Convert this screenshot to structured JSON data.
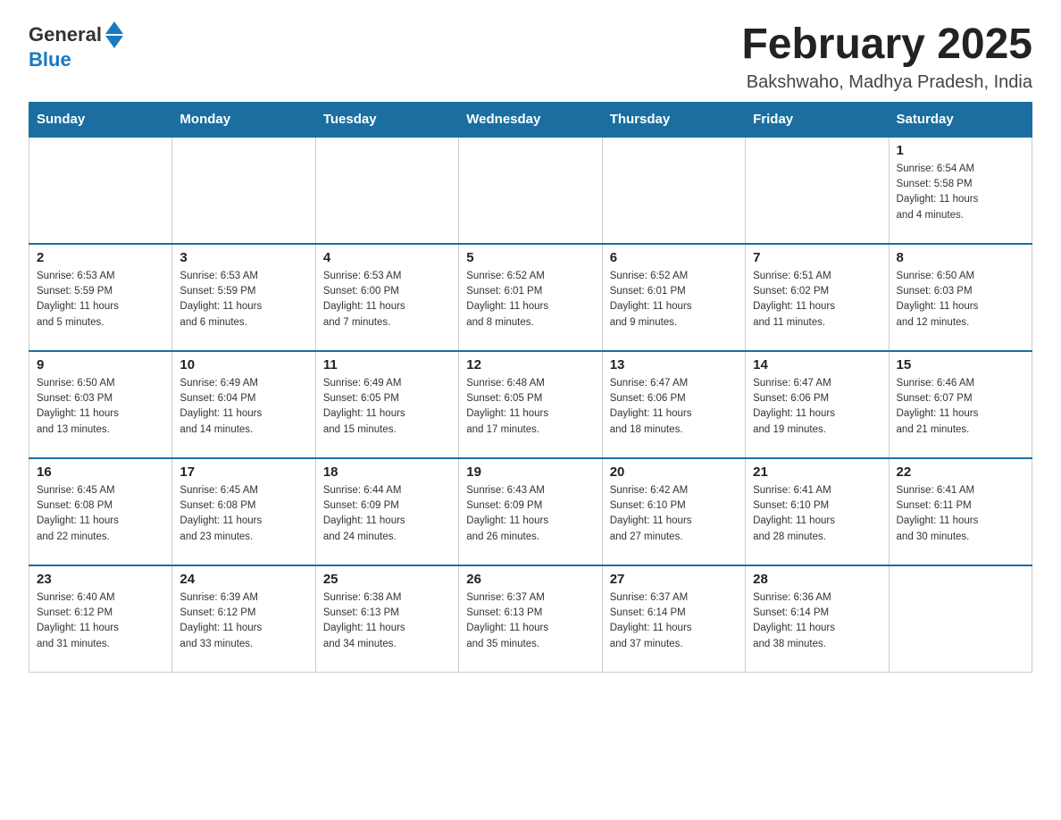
{
  "header": {
    "logo_general": "General",
    "logo_blue": "Blue",
    "title": "February 2025",
    "subtitle": "Bakshwaho, Madhya Pradesh, India"
  },
  "weekdays": [
    "Sunday",
    "Monday",
    "Tuesday",
    "Wednesday",
    "Thursday",
    "Friday",
    "Saturday"
  ],
  "weeks": [
    [
      {
        "day": "",
        "info": ""
      },
      {
        "day": "",
        "info": ""
      },
      {
        "day": "",
        "info": ""
      },
      {
        "day": "",
        "info": ""
      },
      {
        "day": "",
        "info": ""
      },
      {
        "day": "",
        "info": ""
      },
      {
        "day": "1",
        "info": "Sunrise: 6:54 AM\nSunset: 5:58 PM\nDaylight: 11 hours\nand 4 minutes."
      }
    ],
    [
      {
        "day": "2",
        "info": "Sunrise: 6:53 AM\nSunset: 5:59 PM\nDaylight: 11 hours\nand 5 minutes."
      },
      {
        "day": "3",
        "info": "Sunrise: 6:53 AM\nSunset: 5:59 PM\nDaylight: 11 hours\nand 6 minutes."
      },
      {
        "day": "4",
        "info": "Sunrise: 6:53 AM\nSunset: 6:00 PM\nDaylight: 11 hours\nand 7 minutes."
      },
      {
        "day": "5",
        "info": "Sunrise: 6:52 AM\nSunset: 6:01 PM\nDaylight: 11 hours\nand 8 minutes."
      },
      {
        "day": "6",
        "info": "Sunrise: 6:52 AM\nSunset: 6:01 PM\nDaylight: 11 hours\nand 9 minutes."
      },
      {
        "day": "7",
        "info": "Sunrise: 6:51 AM\nSunset: 6:02 PM\nDaylight: 11 hours\nand 11 minutes."
      },
      {
        "day": "8",
        "info": "Sunrise: 6:50 AM\nSunset: 6:03 PM\nDaylight: 11 hours\nand 12 minutes."
      }
    ],
    [
      {
        "day": "9",
        "info": "Sunrise: 6:50 AM\nSunset: 6:03 PM\nDaylight: 11 hours\nand 13 minutes."
      },
      {
        "day": "10",
        "info": "Sunrise: 6:49 AM\nSunset: 6:04 PM\nDaylight: 11 hours\nand 14 minutes."
      },
      {
        "day": "11",
        "info": "Sunrise: 6:49 AM\nSunset: 6:05 PM\nDaylight: 11 hours\nand 15 minutes."
      },
      {
        "day": "12",
        "info": "Sunrise: 6:48 AM\nSunset: 6:05 PM\nDaylight: 11 hours\nand 17 minutes."
      },
      {
        "day": "13",
        "info": "Sunrise: 6:47 AM\nSunset: 6:06 PM\nDaylight: 11 hours\nand 18 minutes."
      },
      {
        "day": "14",
        "info": "Sunrise: 6:47 AM\nSunset: 6:06 PM\nDaylight: 11 hours\nand 19 minutes."
      },
      {
        "day": "15",
        "info": "Sunrise: 6:46 AM\nSunset: 6:07 PM\nDaylight: 11 hours\nand 21 minutes."
      }
    ],
    [
      {
        "day": "16",
        "info": "Sunrise: 6:45 AM\nSunset: 6:08 PM\nDaylight: 11 hours\nand 22 minutes."
      },
      {
        "day": "17",
        "info": "Sunrise: 6:45 AM\nSunset: 6:08 PM\nDaylight: 11 hours\nand 23 minutes."
      },
      {
        "day": "18",
        "info": "Sunrise: 6:44 AM\nSunset: 6:09 PM\nDaylight: 11 hours\nand 24 minutes."
      },
      {
        "day": "19",
        "info": "Sunrise: 6:43 AM\nSunset: 6:09 PM\nDaylight: 11 hours\nand 26 minutes."
      },
      {
        "day": "20",
        "info": "Sunrise: 6:42 AM\nSunset: 6:10 PM\nDaylight: 11 hours\nand 27 minutes."
      },
      {
        "day": "21",
        "info": "Sunrise: 6:41 AM\nSunset: 6:10 PM\nDaylight: 11 hours\nand 28 minutes."
      },
      {
        "day": "22",
        "info": "Sunrise: 6:41 AM\nSunset: 6:11 PM\nDaylight: 11 hours\nand 30 minutes."
      }
    ],
    [
      {
        "day": "23",
        "info": "Sunrise: 6:40 AM\nSunset: 6:12 PM\nDaylight: 11 hours\nand 31 minutes."
      },
      {
        "day": "24",
        "info": "Sunrise: 6:39 AM\nSunset: 6:12 PM\nDaylight: 11 hours\nand 33 minutes."
      },
      {
        "day": "25",
        "info": "Sunrise: 6:38 AM\nSunset: 6:13 PM\nDaylight: 11 hours\nand 34 minutes."
      },
      {
        "day": "26",
        "info": "Sunrise: 6:37 AM\nSunset: 6:13 PM\nDaylight: 11 hours\nand 35 minutes."
      },
      {
        "day": "27",
        "info": "Sunrise: 6:37 AM\nSunset: 6:14 PM\nDaylight: 11 hours\nand 37 minutes."
      },
      {
        "day": "28",
        "info": "Sunrise: 6:36 AM\nSunset: 6:14 PM\nDaylight: 11 hours\nand 38 minutes."
      },
      {
        "day": "",
        "info": ""
      }
    ]
  ]
}
